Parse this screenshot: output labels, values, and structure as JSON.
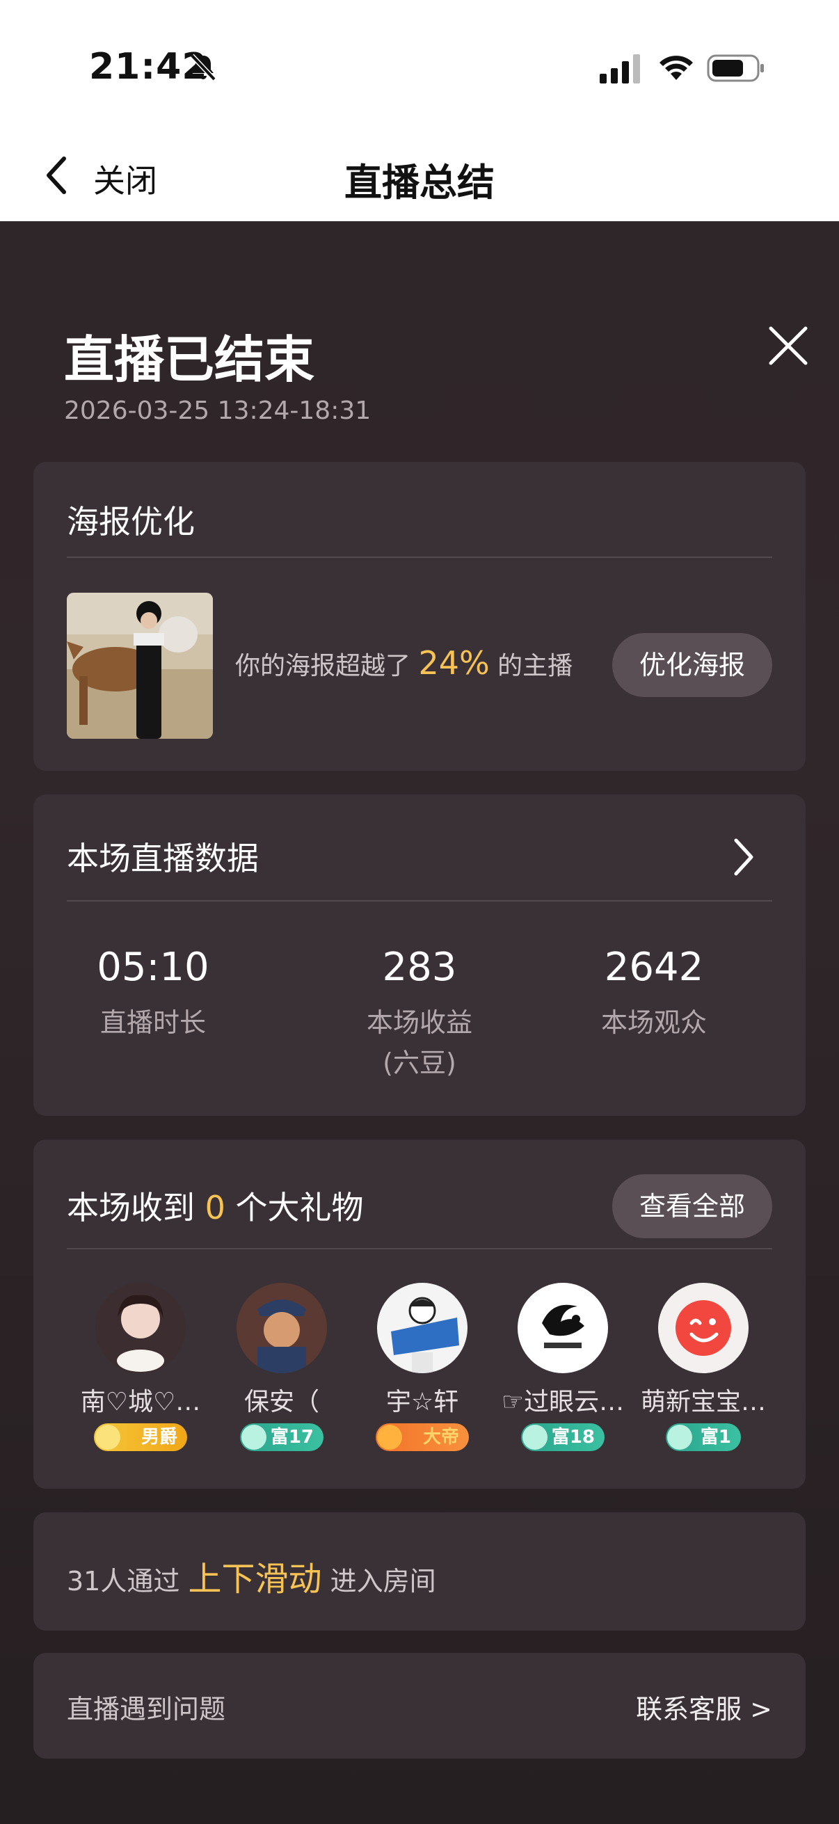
{
  "status": {
    "time": "21:42"
  },
  "nav": {
    "back_label": "关闭",
    "title": "直播总结"
  },
  "summary": {
    "title": "直播已结束",
    "time_range": "2026-03-25 13:24-18:31"
  },
  "poster": {
    "title": "海报优化",
    "text_prefix": "你的海报超越了",
    "percent": "24%",
    "text_suffix": "的主播",
    "button": "优化海报"
  },
  "live_data": {
    "title": "本场直播数据",
    "stats": [
      {
        "value": "05:10",
        "label": "直播时长"
      },
      {
        "value": "283",
        "label": "本场收益\n(六豆)"
      },
      {
        "value": "2642",
        "label": "本场观众"
      }
    ]
  },
  "gifts": {
    "title_prefix": "本场收到",
    "count": "0",
    "title_suffix": "个大礼物",
    "button": "查看全部",
    "users": [
      {
        "name": "南♡城♡…",
        "badge": "男爵"
      },
      {
        "name": "保安（",
        "badge": "富17"
      },
      {
        "name": "宇☆轩",
        "badge": "大帝"
      },
      {
        "name": "☞过眼云…",
        "badge": "富18"
      },
      {
        "name": "萌新宝宝…",
        "badge": "富1"
      }
    ]
  },
  "swipe": {
    "prefix": "31人通过",
    "highlight": "上下滑动",
    "suffix": "进入房间"
  },
  "problem": {
    "text": "直播遇到问题",
    "link": "联系客服 >"
  }
}
